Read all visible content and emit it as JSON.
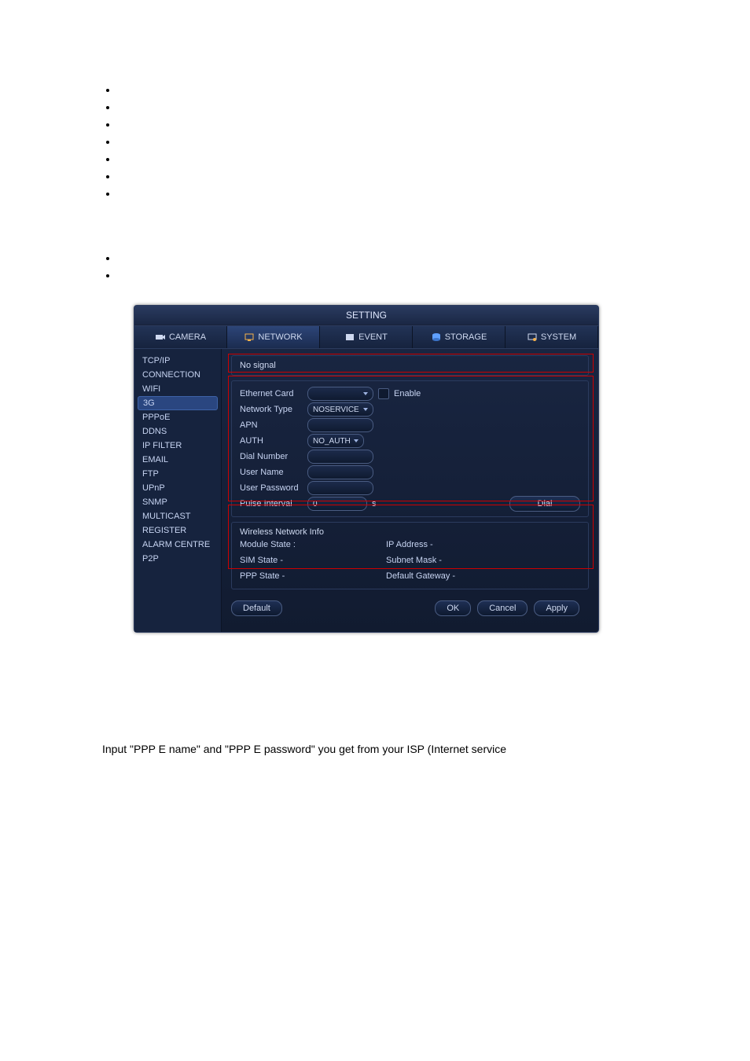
{
  "bullets1": [
    "",
    "",
    "",
    "",
    "",
    "",
    ""
  ],
  "bullets2": [
    "",
    ""
  ],
  "dialog": {
    "title": "SETTING",
    "tabs": [
      "CAMERA",
      "NETWORK",
      "EVENT",
      "STORAGE",
      "SYSTEM"
    ],
    "side": [
      "TCP/IP",
      "CONNECTION",
      "WIFI",
      "3G",
      "PPPoE",
      "DDNS",
      "IP FILTER",
      "EMAIL",
      "FTP",
      "UPnP",
      "SNMP",
      "MULTICAST",
      "REGISTER",
      "ALARM CENTRE",
      "P2P"
    ],
    "pane1_status": "No signal",
    "fields": {
      "ethernet_card": "Ethernet Card",
      "ethernet_card_val": "",
      "enable": "Enable",
      "network_type": "Network Type",
      "network_type_val": "NOSERVICE",
      "apn": "APN",
      "apn_val": "",
      "auth": "AUTH",
      "auth_val": "NO_AUTH",
      "dial_number": "Dial Number",
      "dial_number_val": "",
      "user_name": "User Name",
      "user_name_val": "",
      "user_password": "User Password",
      "user_password_val": "",
      "pulse_interval": "Pulse Interval",
      "pulse_interval_val": "0",
      "pulse_unit": "s",
      "dial_btn": "Dial",
      "wni_head": "Wireless Network Info",
      "module_state": "Module State :",
      "sim_state": "SIM State  -",
      "ppp_state": "PPP State  -",
      "ip_addr": "IP Address  -",
      "subnet": "Subnet Mask  -",
      "gateway": "Default Gateway  -"
    },
    "buttons": {
      "default": "Default",
      "ok": "OK",
      "cancel": "Cancel",
      "apply": "Apply"
    }
  },
  "footer": "Input \"PPP E name\" and \"PPP E password\" you get from your ISP (Internet service"
}
